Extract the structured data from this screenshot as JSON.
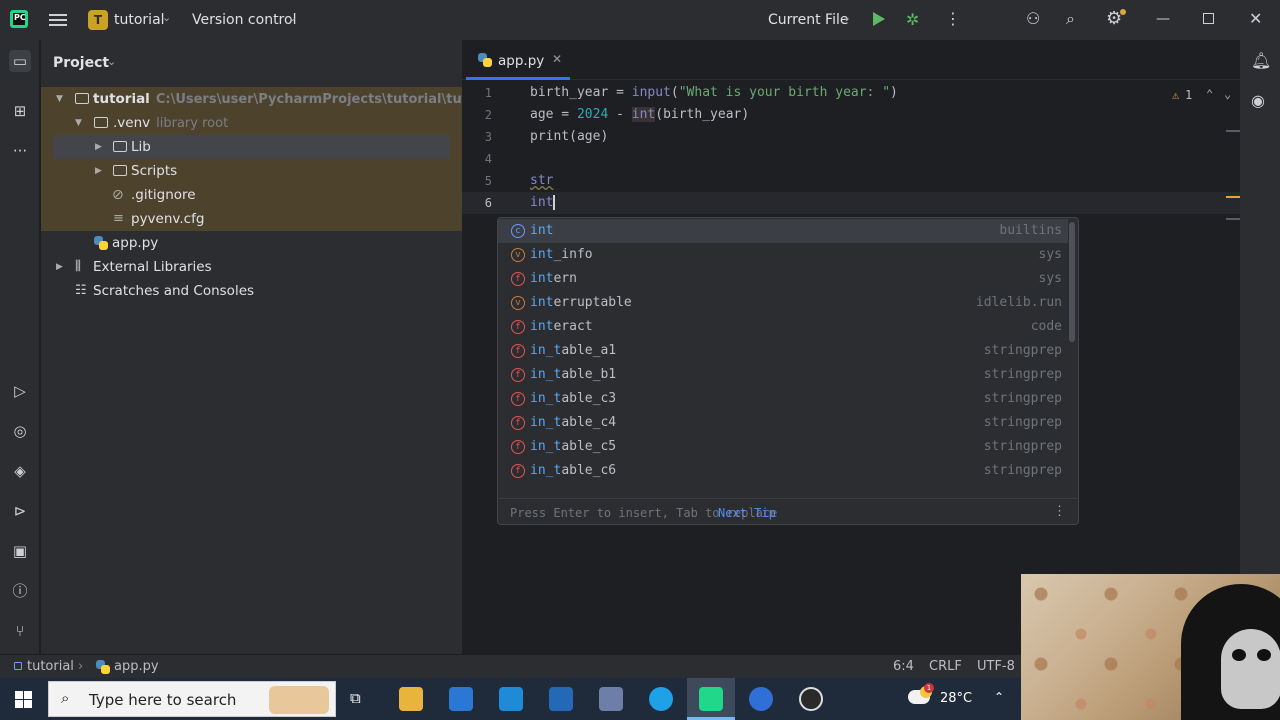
{
  "titlebar": {
    "project_badge": "T",
    "project_name": "tutorial",
    "vcs_label": "Version control",
    "run_config": "Current File"
  },
  "project_panel": {
    "title": "Project",
    "tree": [
      {
        "label": "tutorial",
        "hint": "C:\\Users\\user\\PycharmProjects\\tutorial\\tutorial"
      },
      {
        "label": ".venv",
        "hint": "library root"
      },
      {
        "label": "Lib",
        "hint": ""
      },
      {
        "label": "Scripts",
        "hint": ""
      },
      {
        "label": ".gitignore",
        "hint": ""
      },
      {
        "label": "pyvenv.cfg",
        "hint": ""
      },
      {
        "label": "app.py",
        "hint": ""
      },
      {
        "label": "External Libraries",
        "hint": ""
      },
      {
        "label": "Scratches and Consoles",
        "hint": ""
      }
    ]
  },
  "editor": {
    "tab_label": "app.py",
    "warning_count": "1",
    "line_numbers": [
      "1",
      "2",
      "3",
      "4",
      "5",
      "6"
    ],
    "lines": [
      {
        "a": "birth_year = ",
        "b": "input",
        "c": "(",
        "d": "\"What is your birth year: \"",
        "e": ")"
      },
      {
        "a": "age = ",
        "b": "2024",
        "c": " - ",
        "d": "int",
        "e": "(birth_year)"
      },
      {
        "a": "print",
        "b": "(age)"
      },
      {},
      {
        "a": "str"
      },
      {
        "a": "int"
      }
    ]
  },
  "completion": {
    "items": [
      {
        "kind": "c",
        "match": "int",
        "rest": "",
        "source": "builtins"
      },
      {
        "kind": "v",
        "match": "int",
        "rest": "_info",
        "source": "sys"
      },
      {
        "kind": "f",
        "match": "int",
        "rest": "ern",
        "source": "sys"
      },
      {
        "kind": "v",
        "match": "int",
        "rest": "erruptable",
        "source": "idlelib.run"
      },
      {
        "kind": "f",
        "match": "int",
        "rest": "eract",
        "source": "code"
      },
      {
        "kind": "f",
        "match": "in_t",
        "rest": "able_a1",
        "source": "stringprep"
      },
      {
        "kind": "f",
        "match": "in_t",
        "rest": "able_b1",
        "source": "stringprep"
      },
      {
        "kind": "f",
        "match": "in_t",
        "rest": "able_c3",
        "source": "stringprep"
      },
      {
        "kind": "f",
        "match": "in_t",
        "rest": "able_c4",
        "source": "stringprep"
      },
      {
        "kind": "f",
        "match": "in_t",
        "rest": "able_c5",
        "source": "stringprep"
      },
      {
        "kind": "f",
        "match": "in_t",
        "rest": "able_c6",
        "source": "stringprep"
      }
    ],
    "footer_hint": "Press Enter to insert, Tab to replace",
    "next_tip": "Next Tip"
  },
  "statusbar": {
    "project": "tutorial",
    "file": "app.py",
    "position": "6:4",
    "line_ending": "CRLF",
    "encoding": "UTF-8"
  },
  "taskbar": {
    "search_placeholder": "Type here to search",
    "weather_badge": "1",
    "temperature": "28°C"
  },
  "colors": {
    "accent": "#3574f0",
    "run_green": "#5fb865",
    "warning": "#e0a73d"
  }
}
